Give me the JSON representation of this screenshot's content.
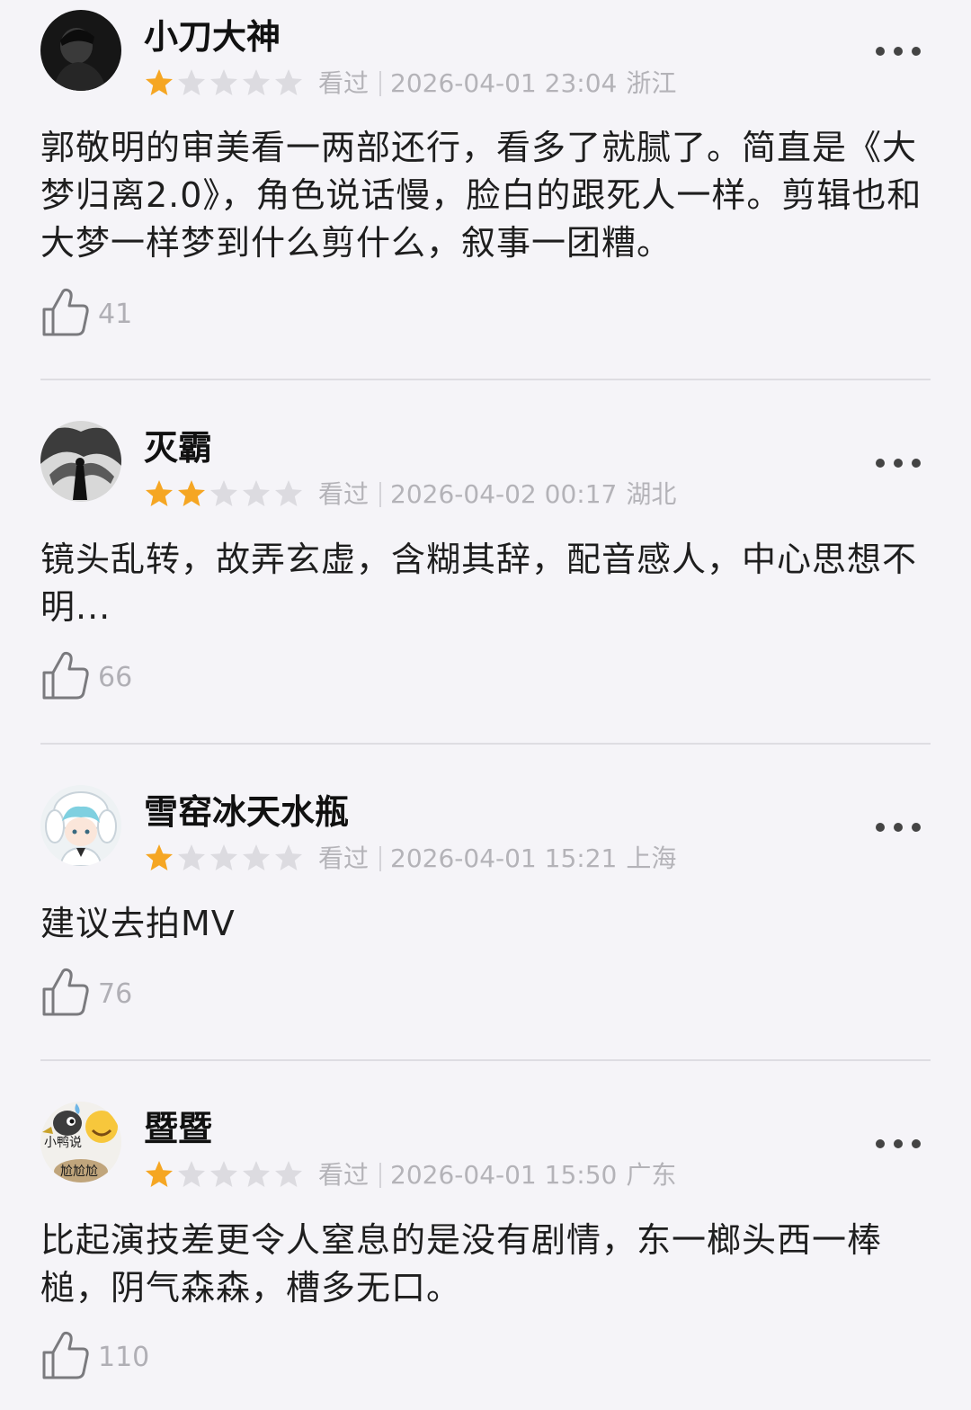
{
  "reviews": [
    {
      "username": "小刀大神",
      "rating": 1,
      "status": "看过",
      "date": "2026-04-01 23:04",
      "region": "浙江",
      "content": "郭敬明的审美看一两部还行，看多了就腻了。简直是《大梦归离2.0》，角色说话慢，脸白的跟死人一样。剪辑也和大梦一样梦到什么剪什么，叙事一团糟。",
      "likes": "41"
    },
    {
      "username": "灭霸",
      "rating": 2,
      "status": "看过",
      "date": "2026-04-02 00:17",
      "region": "湖北",
      "content": "镜头乱转，故弄玄虚，含糊其辞，配音感人，中心思想不明...",
      "likes": "66"
    },
    {
      "username": "雪窑冰天水瓶",
      "rating": 1,
      "status": "看过",
      "date": "2026-04-01 15:21",
      "region": "上海",
      "content": "建议去拍MV",
      "likes": "76"
    },
    {
      "username": "暨暨",
      "rating": 1,
      "status": "看过",
      "date": "2026-04-01 15:50",
      "region": "广东",
      "content": "比起演技差更令人窒息的是没有剧情，东一榔头西一棒槌，阴气森森，槽多无口。",
      "likes": "110",
      "avatar_text_top": "小鸭说",
      "avatar_text_bottom": "尬尬尬"
    }
  ],
  "colors": {
    "star_filled": "#f5a623",
    "star_empty": "#dcdbe0",
    "background": "#f5f4f8",
    "meta_text": "#b4b3b8"
  },
  "icons": {
    "like": "thumbs-up-icon",
    "more": "more-dots-icon",
    "star": "star-icon"
  }
}
